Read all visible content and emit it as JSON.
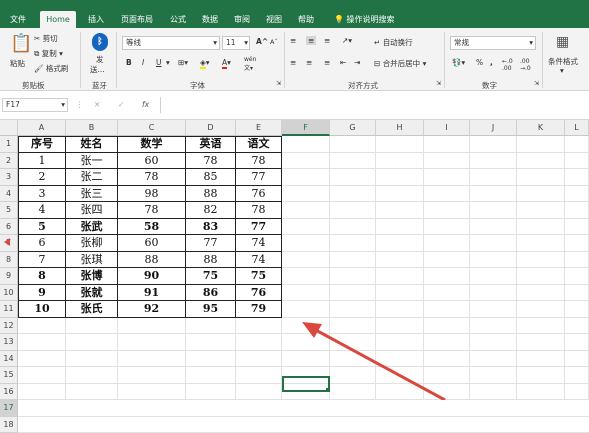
{
  "tabs": [
    "文件",
    "Home",
    "插入",
    "页面布局",
    "公式",
    "数据",
    "审阅",
    "视图",
    "帮助"
  ],
  "active_tab": "Home",
  "tell_me": "操作说明搜索",
  "ribbon": {
    "clipboard": {
      "paste": "粘贴",
      "cut": "剪切",
      "copy": "复制",
      "format_painter": "格式刷",
      "label": "剪贴板"
    },
    "bluetooth": {
      "send": "发",
      "send2": "送...",
      "label": "蓝牙"
    },
    "font": {
      "name": "等线",
      "size": "11",
      "bold": "B",
      "italic": "I",
      "underline": "U",
      "grow": "A",
      "shrink": "A",
      "font_color": "A",
      "wen": "wén",
      "label": "字体"
    },
    "alignment": {
      "wrap": "自动换行",
      "merge": "合并后居中",
      "label": "对齐方式"
    },
    "number": {
      "format": "常规",
      "percent": "%",
      "comma": ",",
      "label": "数字"
    },
    "styles": {
      "conditional": "条件格式"
    }
  },
  "name_box": "F17",
  "fx": "fx",
  "columns": [
    "A",
    "B",
    "C",
    "D",
    "E",
    "F",
    "G",
    "H",
    "I",
    "J",
    "K",
    "L"
  ],
  "rows": [
    "1",
    "2",
    "3",
    "4",
    "5",
    "6",
    "7",
    "8",
    "9",
    "10",
    "11",
    "12",
    "13",
    "14",
    "15",
    "16",
    "17",
    "18"
  ],
  "table": {
    "header": [
      "序号",
      "姓名",
      "数学",
      "英语",
      "语文"
    ],
    "rows": [
      {
        "cells": [
          "1",
          "张一",
          "60",
          "78",
          "78"
        ],
        "bold": false
      },
      {
        "cells": [
          "2",
          "张二",
          "78",
          "85",
          "77"
        ],
        "bold": false
      },
      {
        "cells": [
          "3",
          "张三",
          "98",
          "88",
          "76"
        ],
        "bold": false
      },
      {
        "cells": [
          "4",
          "张四",
          "78",
          "82",
          "78"
        ],
        "bold": false
      },
      {
        "cells": [
          "5",
          "张武",
          "58",
          "83",
          "77"
        ],
        "bold": true
      },
      {
        "cells": [
          "6",
          "张柳",
          "60",
          "77",
          "74"
        ],
        "bold": false
      },
      {
        "cells": [
          "7",
          "张琪",
          "88",
          "88",
          "74"
        ],
        "bold": false
      },
      {
        "cells": [
          "8",
          "张博",
          "90",
          "75",
          "75"
        ],
        "bold": true
      },
      {
        "cells": [
          "9",
          "张就",
          "91",
          "86",
          "76"
        ],
        "bold": true
      },
      {
        "cells": [
          "10",
          "张氏",
          "92",
          "95",
          "79"
        ],
        "bold": true
      }
    ]
  },
  "selected_cell": "F17",
  "colors": {
    "accent": "#217346",
    "arrow": "#d9473d"
  }
}
